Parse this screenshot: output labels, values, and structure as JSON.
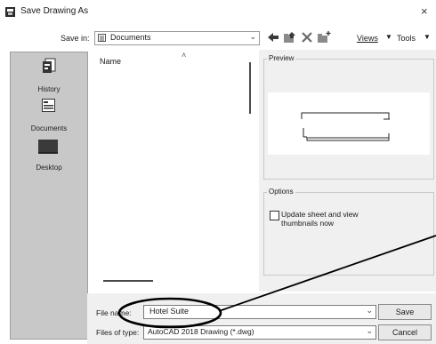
{
  "window": {
    "title": "Save Drawing As",
    "close_glyph": "×",
    "icon": "autocad-app-icon"
  },
  "toolbar": {
    "save_in_label": "Save in:",
    "save_in_value": "Documents",
    "save_in_icon": "documents-folder-icon",
    "icons": [
      "back-arrow-icon",
      "up-folder-icon",
      "delete-icon",
      "new-folder-icon"
    ],
    "views_label": "Views",
    "tools_label": "Tools"
  },
  "sidebar": {
    "items": [
      {
        "label": "History",
        "icon": "history-icon"
      },
      {
        "label": "Documents",
        "icon": "documents-icon"
      },
      {
        "label": "Desktop",
        "icon": "desktop-icon"
      }
    ]
  },
  "file_list": {
    "column_name": "Name",
    "sort_glyph": "˄"
  },
  "preview": {
    "label": "Preview"
  },
  "options": {
    "label": "Options",
    "thumbnail_checkbox_label": "Update sheet and view thumbnails now",
    "thumbnail_checked": false
  },
  "bottom": {
    "file_name_label": "File name:",
    "file_name_value": "Hotel Suite",
    "save_button": "Save",
    "file_type_label": "Files of type:",
    "file_type_value": "AutoCAD 2018 Drawing (*.dwg)",
    "cancel_button": "Cancel"
  },
  "colors": {
    "sidebar_bg": "#c8c8c8",
    "pane_bg": "#f0f0f0",
    "annotation": "#000000"
  }
}
